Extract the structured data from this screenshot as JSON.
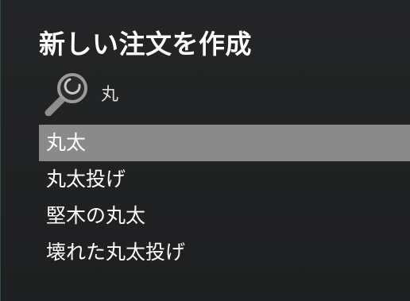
{
  "dialog": {
    "title": "新しい注文を作成"
  },
  "search": {
    "value": "丸",
    "icon": "search-icon"
  },
  "results": [
    {
      "label": "丸太",
      "selected": true
    },
    {
      "label": "丸太投げ",
      "selected": false
    },
    {
      "label": "堅木の丸太",
      "selected": false
    },
    {
      "label": "壊れた丸太投げ",
      "selected": false
    }
  ],
  "colors": {
    "background": "#1f2021",
    "selected_row": "#8a8a8a",
    "text": "#ffffff"
  }
}
